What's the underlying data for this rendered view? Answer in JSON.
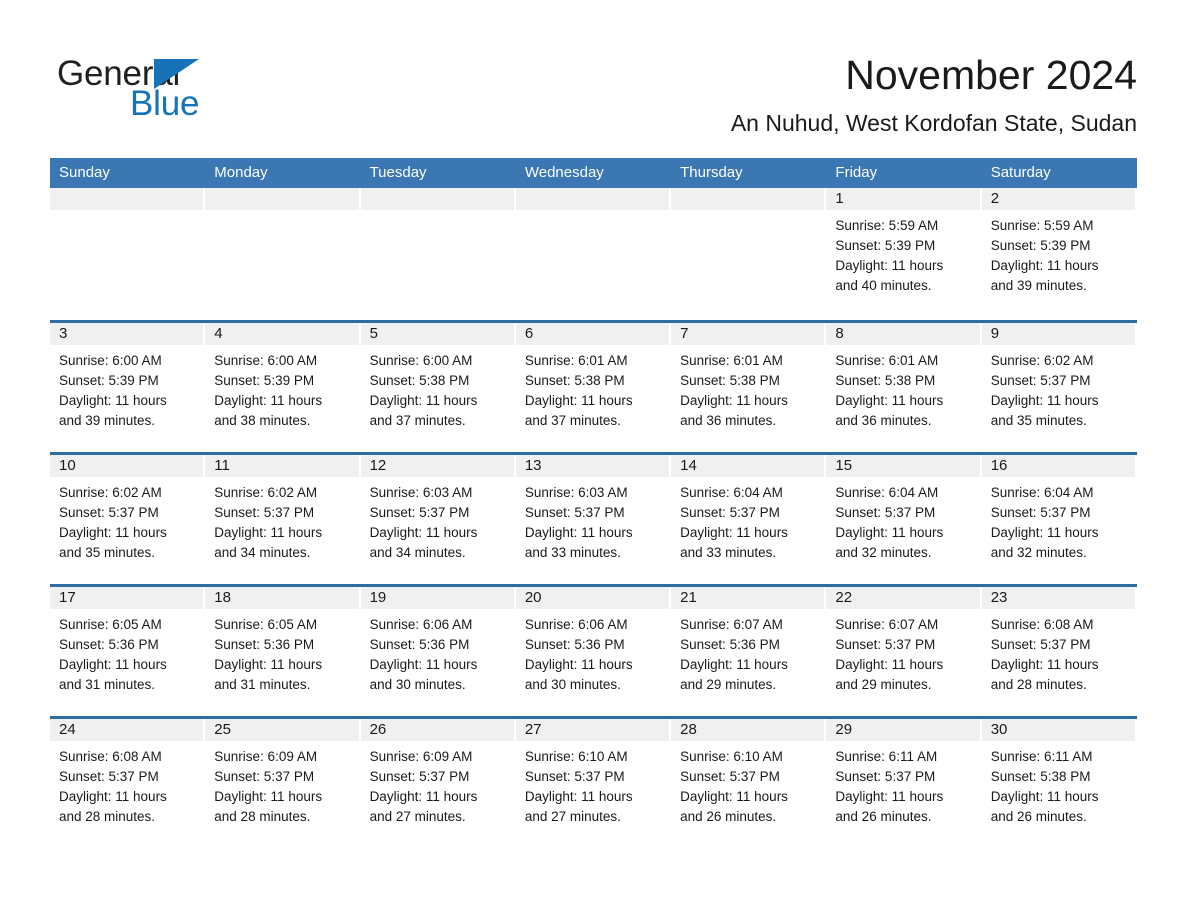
{
  "logo": {
    "word_one": "General",
    "word_two": "Blue",
    "triangle_color": "#1673b8",
    "text_color": "#231f20"
  },
  "header": {
    "title": "November 2024",
    "subtitle": "An Nuhud, West Kordofan State, Sudan"
  },
  "colors": {
    "header_blue": "#3a77b3",
    "row_divider_blue": "#2e6da4",
    "day_band_gray": "#f0f0f0",
    "cell_white": "#ffffff",
    "text": "#1a1a1a"
  },
  "calendar": {
    "weekday_headers": [
      "Sunday",
      "Monday",
      "Tuesday",
      "Wednesday",
      "Thursday",
      "Friday",
      "Saturday"
    ],
    "weeks": [
      [
        {
          "day": "",
          "empty": true
        },
        {
          "day": "",
          "empty": true
        },
        {
          "day": "",
          "empty": true
        },
        {
          "day": "",
          "empty": true
        },
        {
          "day": "",
          "empty": true
        },
        {
          "day": "1",
          "sunrise": "Sunrise: 5:59 AM",
          "sunset": "Sunset: 5:39 PM",
          "daylight_1": "Daylight: 11 hours",
          "daylight_2": "and 40 minutes."
        },
        {
          "day": "2",
          "sunrise": "Sunrise: 5:59 AM",
          "sunset": "Sunset: 5:39 PM",
          "daylight_1": "Daylight: 11 hours",
          "daylight_2": "and 39 minutes."
        }
      ],
      [
        {
          "day": "3",
          "sunrise": "Sunrise: 6:00 AM",
          "sunset": "Sunset: 5:39 PM",
          "daylight_1": "Daylight: 11 hours",
          "daylight_2": "and 39 minutes."
        },
        {
          "day": "4",
          "sunrise": "Sunrise: 6:00 AM",
          "sunset": "Sunset: 5:39 PM",
          "daylight_1": "Daylight: 11 hours",
          "daylight_2": "and 38 minutes."
        },
        {
          "day": "5",
          "sunrise": "Sunrise: 6:00 AM",
          "sunset": "Sunset: 5:38 PM",
          "daylight_1": "Daylight: 11 hours",
          "daylight_2": "and 37 minutes."
        },
        {
          "day": "6",
          "sunrise": "Sunrise: 6:01 AM",
          "sunset": "Sunset: 5:38 PM",
          "daylight_1": "Daylight: 11 hours",
          "daylight_2": "and 37 minutes."
        },
        {
          "day": "7",
          "sunrise": "Sunrise: 6:01 AM",
          "sunset": "Sunset: 5:38 PM",
          "daylight_1": "Daylight: 11 hours",
          "daylight_2": "and 36 minutes."
        },
        {
          "day": "8",
          "sunrise": "Sunrise: 6:01 AM",
          "sunset": "Sunset: 5:38 PM",
          "daylight_1": "Daylight: 11 hours",
          "daylight_2": "and 36 minutes."
        },
        {
          "day": "9",
          "sunrise": "Sunrise: 6:02 AM",
          "sunset": "Sunset: 5:37 PM",
          "daylight_1": "Daylight: 11 hours",
          "daylight_2": "and 35 minutes."
        }
      ],
      [
        {
          "day": "10",
          "sunrise": "Sunrise: 6:02 AM",
          "sunset": "Sunset: 5:37 PM",
          "daylight_1": "Daylight: 11 hours",
          "daylight_2": "and 35 minutes."
        },
        {
          "day": "11",
          "sunrise": "Sunrise: 6:02 AM",
          "sunset": "Sunset: 5:37 PM",
          "daylight_1": "Daylight: 11 hours",
          "daylight_2": "and 34 minutes."
        },
        {
          "day": "12",
          "sunrise": "Sunrise: 6:03 AM",
          "sunset": "Sunset: 5:37 PM",
          "daylight_1": "Daylight: 11 hours",
          "daylight_2": "and 34 minutes."
        },
        {
          "day": "13",
          "sunrise": "Sunrise: 6:03 AM",
          "sunset": "Sunset: 5:37 PM",
          "daylight_1": "Daylight: 11 hours",
          "daylight_2": "and 33 minutes."
        },
        {
          "day": "14",
          "sunrise": "Sunrise: 6:04 AM",
          "sunset": "Sunset: 5:37 PM",
          "daylight_1": "Daylight: 11 hours",
          "daylight_2": "and 33 minutes."
        },
        {
          "day": "15",
          "sunrise": "Sunrise: 6:04 AM",
          "sunset": "Sunset: 5:37 PM",
          "daylight_1": "Daylight: 11 hours",
          "daylight_2": "and 32 minutes."
        },
        {
          "day": "16",
          "sunrise": "Sunrise: 6:04 AM",
          "sunset": "Sunset: 5:37 PM",
          "daylight_1": "Daylight: 11 hours",
          "daylight_2": "and 32 minutes."
        }
      ],
      [
        {
          "day": "17",
          "sunrise": "Sunrise: 6:05 AM",
          "sunset": "Sunset: 5:36 PM",
          "daylight_1": "Daylight: 11 hours",
          "daylight_2": "and 31 minutes."
        },
        {
          "day": "18",
          "sunrise": "Sunrise: 6:05 AM",
          "sunset": "Sunset: 5:36 PM",
          "daylight_1": "Daylight: 11 hours",
          "daylight_2": "and 31 minutes."
        },
        {
          "day": "19",
          "sunrise": "Sunrise: 6:06 AM",
          "sunset": "Sunset: 5:36 PM",
          "daylight_1": "Daylight: 11 hours",
          "daylight_2": "and 30 minutes."
        },
        {
          "day": "20",
          "sunrise": "Sunrise: 6:06 AM",
          "sunset": "Sunset: 5:36 PM",
          "daylight_1": "Daylight: 11 hours",
          "daylight_2": "and 30 minutes."
        },
        {
          "day": "21",
          "sunrise": "Sunrise: 6:07 AM",
          "sunset": "Sunset: 5:36 PM",
          "daylight_1": "Daylight: 11 hours",
          "daylight_2": "and 29 minutes."
        },
        {
          "day": "22",
          "sunrise": "Sunrise: 6:07 AM",
          "sunset": "Sunset: 5:37 PM",
          "daylight_1": "Daylight: 11 hours",
          "daylight_2": "and 29 minutes."
        },
        {
          "day": "23",
          "sunrise": "Sunrise: 6:08 AM",
          "sunset": "Sunset: 5:37 PM",
          "daylight_1": "Daylight: 11 hours",
          "daylight_2": "and 28 minutes."
        }
      ],
      [
        {
          "day": "24",
          "sunrise": "Sunrise: 6:08 AM",
          "sunset": "Sunset: 5:37 PM",
          "daylight_1": "Daylight: 11 hours",
          "daylight_2": "and 28 minutes."
        },
        {
          "day": "25",
          "sunrise": "Sunrise: 6:09 AM",
          "sunset": "Sunset: 5:37 PM",
          "daylight_1": "Daylight: 11 hours",
          "daylight_2": "and 28 minutes."
        },
        {
          "day": "26",
          "sunrise": "Sunrise: 6:09 AM",
          "sunset": "Sunset: 5:37 PM",
          "daylight_1": "Daylight: 11 hours",
          "daylight_2": "and 27 minutes."
        },
        {
          "day": "27",
          "sunrise": "Sunrise: 6:10 AM",
          "sunset": "Sunset: 5:37 PM",
          "daylight_1": "Daylight: 11 hours",
          "daylight_2": "and 27 minutes."
        },
        {
          "day": "28",
          "sunrise": "Sunrise: 6:10 AM",
          "sunset": "Sunset: 5:37 PM",
          "daylight_1": "Daylight: 11 hours",
          "daylight_2": "and 26 minutes."
        },
        {
          "day": "29",
          "sunrise": "Sunrise: 6:11 AM",
          "sunset": "Sunset: 5:37 PM",
          "daylight_1": "Daylight: 11 hours",
          "daylight_2": "and 26 minutes."
        },
        {
          "day": "30",
          "sunrise": "Sunrise: 6:11 AM",
          "sunset": "Sunset: 5:38 PM",
          "daylight_1": "Daylight: 11 hours",
          "daylight_2": "and 26 minutes."
        }
      ]
    ]
  }
}
